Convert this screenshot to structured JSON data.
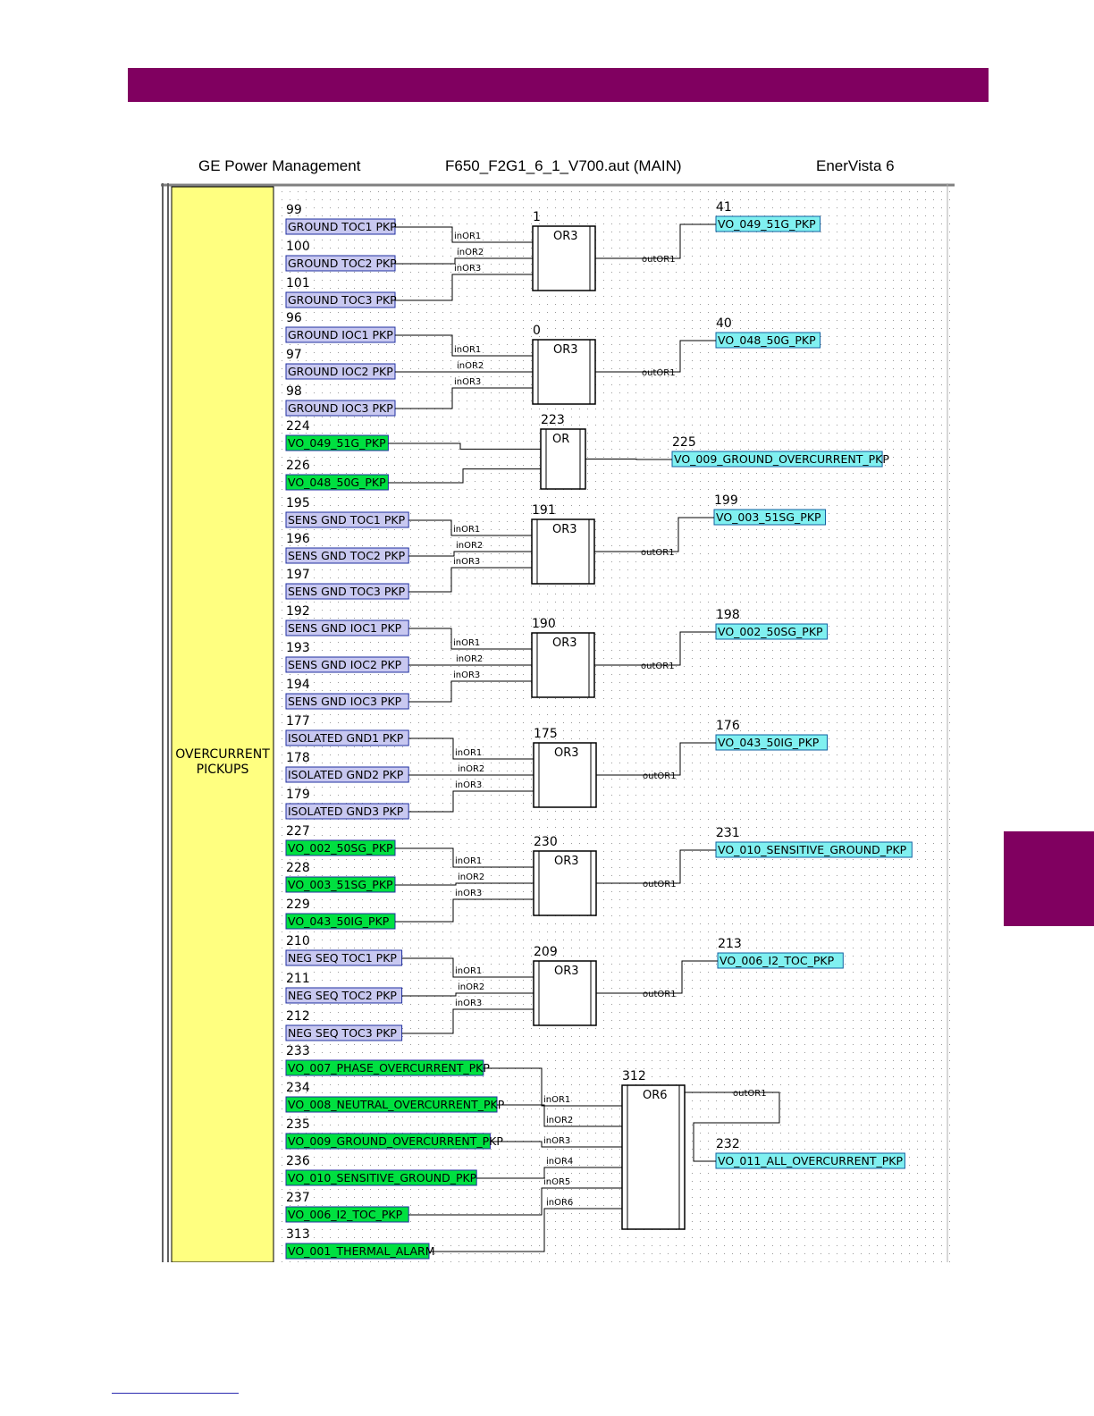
{
  "header": {
    "left": "GE Power Management",
    "center": "F650_F2G1_6_1_V700.aut (MAIN)",
    "right": "EnerVista 6"
  },
  "section_label": [
    "OVERCURRENT",
    "PICKUPS"
  ],
  "colors": {
    "band": "#800060",
    "section_fill": "#ffff80",
    "input_fill": "#c8c8f0",
    "vo_input_fill": "#00e040",
    "output_fill": "#80f0f0"
  },
  "groups": [
    {
      "id": "1",
      "gate": "OR3",
      "inputs": [
        {
          "id": "99",
          "label": "GROUND TOC1 PKP",
          "kind": "input"
        },
        {
          "id": "100",
          "label": "GROUND TOC2 PKP",
          "kind": "input"
        },
        {
          "id": "101",
          "label": "GROUND TOC3 PKP",
          "kind": "input"
        }
      ],
      "in_labels": [
        "inOR1",
        "inOR2",
        "inOR3"
      ],
      "out_label": "outOR1",
      "output": {
        "id": "41",
        "label": "VO_049_51G_PKP"
      }
    },
    {
      "id": "0",
      "gate": "OR3",
      "inputs": [
        {
          "id": "96",
          "label": "GROUND IOC1 PKP",
          "kind": "input"
        },
        {
          "id": "97",
          "label": "GROUND IOC2 PKP",
          "kind": "input"
        },
        {
          "id": "98",
          "label": "GROUND IOC3 PKP",
          "kind": "input"
        }
      ],
      "in_labels": [
        "inOR1",
        "inOR2",
        "inOR3"
      ],
      "out_label": "outOR1",
      "output": {
        "id": "40",
        "label": "VO_048_50G_PKP"
      }
    },
    {
      "id": "223",
      "gate": "OR",
      "inputs": [
        {
          "id": "224",
          "label": "VO_049_51G_PKP",
          "kind": "vo"
        },
        {
          "id": "226",
          "label": "VO_048_50G_PKP",
          "kind": "vo"
        }
      ],
      "in_labels": [],
      "out_label": "",
      "output": {
        "id": "225",
        "label": "VO_009_GROUND_OVERCURRENT_PKP"
      }
    },
    {
      "id": "191",
      "gate": "OR3",
      "inputs": [
        {
          "id": "195",
          "label": "SENS GND TOC1 PKP",
          "kind": "input"
        },
        {
          "id": "196",
          "label": "SENS GND TOC2 PKP",
          "kind": "input"
        },
        {
          "id": "197",
          "label": "SENS GND TOC3 PKP",
          "kind": "input"
        }
      ],
      "in_labels": [
        "inOR1",
        "inOR2",
        "inOR3"
      ],
      "out_label": "outOR1",
      "output": {
        "id": "199",
        "label": "VO_003_51SG_PKP"
      }
    },
    {
      "id": "190",
      "gate": "OR3",
      "inputs": [
        {
          "id": "192",
          "label": "SENS GND IOC1 PKP",
          "kind": "input"
        },
        {
          "id": "193",
          "label": "SENS GND IOC2 PKP",
          "kind": "input"
        },
        {
          "id": "194",
          "label": "SENS GND IOC3 PKP",
          "kind": "input"
        }
      ],
      "in_labels": [
        "inOR1",
        "inOR2",
        "inOR3"
      ],
      "out_label": "outOR1",
      "output": {
        "id": "198",
        "label": "VO_002_50SG_PKP"
      }
    },
    {
      "id": "175",
      "gate": "OR3",
      "inputs": [
        {
          "id": "177",
          "label": "ISOLATED GND1 PKP",
          "kind": "input"
        },
        {
          "id": "178",
          "label": "ISOLATED GND2 PKP",
          "kind": "input"
        },
        {
          "id": "179",
          "label": "ISOLATED GND3 PKP",
          "kind": "input"
        }
      ],
      "in_labels": [
        "inOR1",
        "inOR2",
        "inOR3"
      ],
      "out_label": "outOR1",
      "output": {
        "id": "176",
        "label": "VO_043_50IG_PKP"
      }
    },
    {
      "id": "230",
      "gate": "OR3",
      "inputs": [
        {
          "id": "227",
          "label": "VO_002_50SG_PKP",
          "kind": "vo"
        },
        {
          "id": "228",
          "label": "VO_003_51SG_PKP",
          "kind": "vo"
        },
        {
          "id": "229",
          "label": "VO_043_50IG_PKP",
          "kind": "vo"
        }
      ],
      "in_labels": [
        "inOR1",
        "inOR2",
        "inOR3"
      ],
      "out_label": "outOR1",
      "output": {
        "id": "231",
        "label": "VO_010_SENSITIVE_GROUND_PKP"
      }
    },
    {
      "id": "209",
      "gate": "OR3",
      "inputs": [
        {
          "id": "210",
          "label": "NEG SEQ TOC1 PKP",
          "kind": "input"
        },
        {
          "id": "211",
          "label": "NEG SEQ TOC2 PKP",
          "kind": "input"
        },
        {
          "id": "212",
          "label": "NEG SEQ TOC3 PKP",
          "kind": "input"
        }
      ],
      "in_labels": [
        "inOR1",
        "inOR2",
        "inOR3"
      ],
      "out_label": "outOR1",
      "output": {
        "id": "213",
        "label": "VO_006_I2_TOC_PKP"
      }
    },
    {
      "id": "312",
      "gate": "OR6",
      "inputs": [
        {
          "id": "233",
          "label": "VO_007_PHASE_OVERCURRENT_PKP",
          "kind": "vo"
        },
        {
          "id": "234",
          "label": "VO_008_NEUTRAL_OVERCURRENT_PKP",
          "kind": "vo"
        },
        {
          "id": "235",
          "label": "VO_009_GROUND_OVERCURRENT_PKP",
          "kind": "vo"
        },
        {
          "id": "236",
          "label": "VO_010_SENSITIVE_GROUND_PKP",
          "kind": "vo"
        },
        {
          "id": "237",
          "label": "VO_006_I2_TOC_PKP",
          "kind": "vo"
        },
        {
          "id": "313",
          "label": "VO_001_THERMAL_ALARM",
          "kind": "vo"
        }
      ],
      "in_labels": [
        "inOR1",
        "inOR2",
        "inOR3",
        "inOR4",
        "inOR5",
        "inOR6"
      ],
      "out_label": "outOR1",
      "output": {
        "id": "232",
        "label": "VO_011_ALL_OVERCURRENT_PKP"
      }
    }
  ]
}
